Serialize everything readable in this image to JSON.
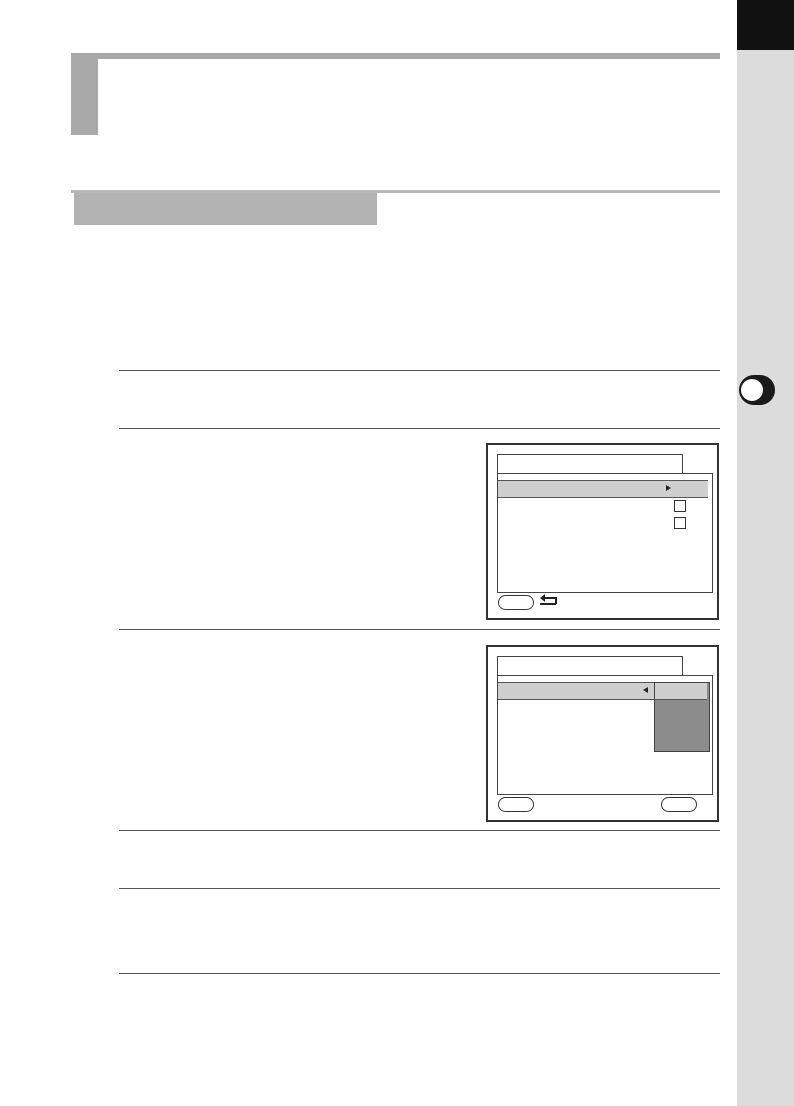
{
  "colors": {
    "side_strip": "#dcdcdc",
    "side_top": "#111111",
    "header_gray": "#a9a9a9",
    "section_gray": "#b3b3b3",
    "highlight": "#cfcfcf",
    "dropdown": "#8c8c8c"
  },
  "icons": {
    "back": "return-arrow-icon",
    "right": "arrow-right-icon",
    "left": "arrow-left-icon"
  },
  "screen1": {
    "checkboxes": [
      false,
      false
    ]
  }
}
